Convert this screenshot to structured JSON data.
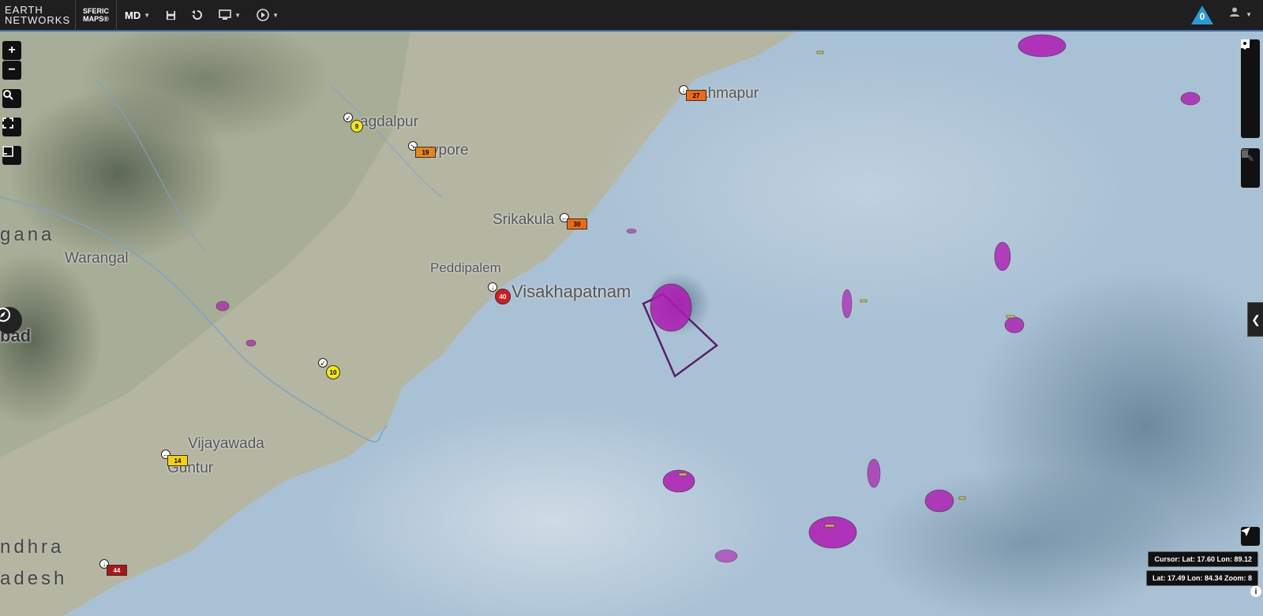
{
  "header": {
    "logo_line1": "EARTH",
    "logo_line2": "NETWORKS",
    "product_line1": "SFERIC",
    "product_line2": "MAPS®",
    "region_selector": "MD",
    "alert_count": "0"
  },
  "icons": [
    "save-icon",
    "undo-icon",
    "display-icon",
    "play-icon",
    "user-icon",
    "zoom-in-icon",
    "zoom-out-icon",
    "zoom-region-icon",
    "fullscreen-icon",
    "legend-icon",
    "compass-icon",
    "draw-line-icon",
    "draw-polygon-icon",
    "draw-rectangle-icon",
    "draw-circle-icon",
    "draw-pin-icon",
    "edit-icon",
    "delete-icon",
    "locate-icon",
    "info-icon"
  ],
  "map_controls": {
    "zoom_in": "+",
    "zoom_out": "−"
  },
  "cities": [
    {
      "name": "agdalpur"
    },
    {
      "name": "ypore"
    },
    {
      "name": "ahmapur"
    },
    {
      "name": "Srikakula"
    },
    {
      "name": "Peddipalem"
    },
    {
      "name": "Visakhapatnam"
    },
    {
      "name": "Warangal"
    },
    {
      "name": "Vijayawada"
    },
    {
      "name": "Guntur"
    },
    {
      "name": "bad"
    }
  ],
  "regions": [
    {
      "name": "gana"
    },
    {
      "name": "ndhra"
    },
    {
      "name": "adesh"
    }
  ],
  "markers": [
    {
      "value": "9",
      "color": "#f5e90a"
    },
    {
      "value": "19",
      "color": "#e8861a"
    },
    {
      "value": "27",
      "color": "#ee6a10"
    },
    {
      "value": "30",
      "color": "#ee6a10"
    },
    {
      "value": "40",
      "color": "#d71920"
    },
    {
      "value": "10",
      "color": "#f5e90a"
    },
    {
      "value": "14",
      "color": "#f5d30a"
    },
    {
      "value": "44",
      "color": "#b01217"
    }
  ],
  "readouts": {
    "cursor": "Cursor: Lat: 17.60 Lon: 89.12",
    "center": "Lat: 17.49 Lon: 84.34 Zoom: 8"
  }
}
